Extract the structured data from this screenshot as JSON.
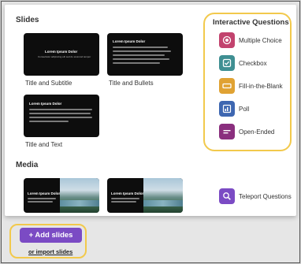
{
  "slides_section": {
    "title": "Slides",
    "items": [
      {
        "label": "Title and Subtitle",
        "thumb_title": "Lorem Ipsum Dolor",
        "thumb_sub": "Consectetur adipiscing elit sed do eiusmod tempor"
      },
      {
        "label": "Title and Bullets",
        "thumb_title": "Lorem Ipsum Dolor"
      },
      {
        "label": "Title and Text",
        "thumb_title": "Lorem Ipsum Dolor"
      }
    ]
  },
  "media_section": {
    "title": "Media",
    "items": [
      {
        "thumb_title": "Lorem Ipsum Dolor"
      },
      {
        "thumb_title": "Lorem Ipsum Dolor"
      }
    ]
  },
  "interactive_questions": {
    "title": "Interactive Questions",
    "items": [
      {
        "label": "Multiple Choice",
        "icon": "radio-icon",
        "color": "#c2436e"
      },
      {
        "label": "Checkbox",
        "icon": "checkbox-icon",
        "color": "#3f8f92"
      },
      {
        "label": "Fill-in-the-Blank",
        "icon": "blank-field-icon",
        "color": "#e0a233"
      },
      {
        "label": "Poll",
        "icon": "poll-icon",
        "color": "#3e67b1"
      },
      {
        "label": "Open-Ended",
        "icon": "text-lines-icon",
        "color": "#8a2f7e"
      }
    ],
    "teleport": {
      "label": "Teleport Questions",
      "icon": "search-icon",
      "color": "#7b4bc4"
    }
  },
  "footer": {
    "add_slides_label": "+ Add slides",
    "import_label": "or import slides"
  },
  "colors": {
    "highlight": "#f2c94c",
    "primary_button": "#7b4bc4"
  }
}
